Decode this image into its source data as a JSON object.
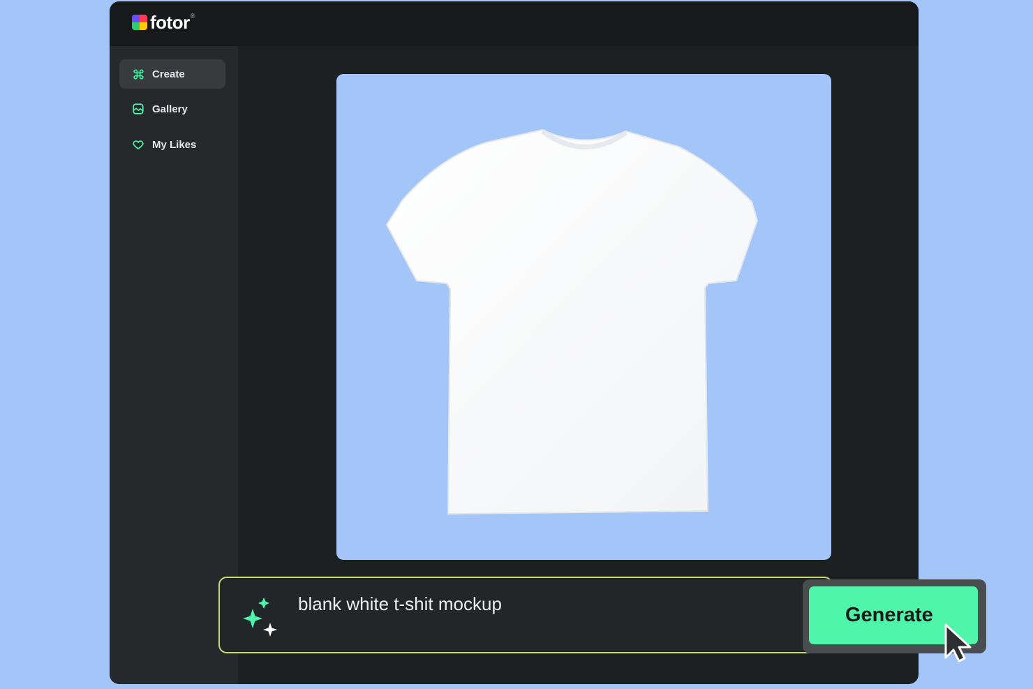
{
  "brand": {
    "name": "fotor",
    "registered": "®"
  },
  "sidebar": {
    "items": [
      {
        "label": "Create",
        "icon": "command-icon",
        "active": true
      },
      {
        "label": "Gallery",
        "icon": "image-icon",
        "active": false
      },
      {
        "label": "My Likes",
        "icon": "heart-icon",
        "active": false
      }
    ]
  },
  "prompt": {
    "value": "blank white t-shit mockup",
    "icon": "sparkle-icon"
  },
  "generate": {
    "label": "Generate"
  },
  "colors": {
    "accent": "#4ff5a8",
    "page_background": "#a3c5f7",
    "window_background": "#1d2021",
    "sidebar_background": "#26292b",
    "prompt_border": "#c9d96a"
  }
}
